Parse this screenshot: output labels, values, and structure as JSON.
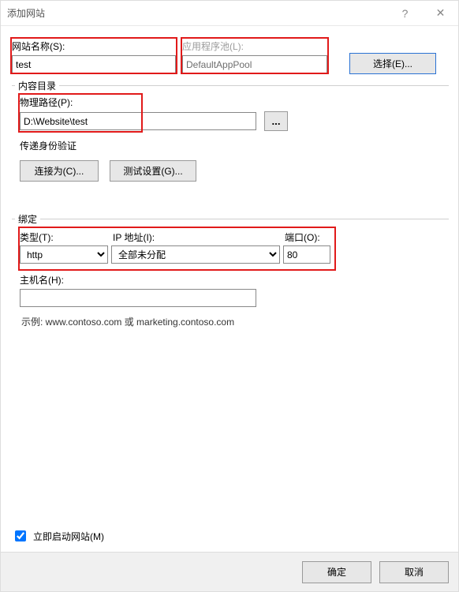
{
  "window": {
    "title": "添加网站",
    "help": "?",
    "close": "✕"
  },
  "site_name": {
    "label": "网站名称(S):",
    "value": "test"
  },
  "app_pool": {
    "label": "应用程序池(L):",
    "value": "DefaultAppPool"
  },
  "select_button": "选择(E)...",
  "content_dir": {
    "legend": "内容目录",
    "path_label": "物理路径(P):",
    "path_value": "D:\\Website\\test",
    "browse": "...",
    "passthrough_label": "传递身份验证",
    "connect_as": "连接为(C)...",
    "test_settings": "测试设置(G)..."
  },
  "binding": {
    "legend": "绑定",
    "type_label": "类型(T):",
    "type_value": "http",
    "ip_label": "IP 地址(I):",
    "ip_value": "全部未分配",
    "port_label": "端口(O):",
    "port_value": "80",
    "host_label": "主机名(H):",
    "host_value": "",
    "example": "示例: www.contoso.com 或 marketing.contoso.com"
  },
  "start_now": {
    "label": "立即启动网站(M)",
    "checked": true
  },
  "footer": {
    "ok": "确定",
    "cancel": "取消"
  }
}
